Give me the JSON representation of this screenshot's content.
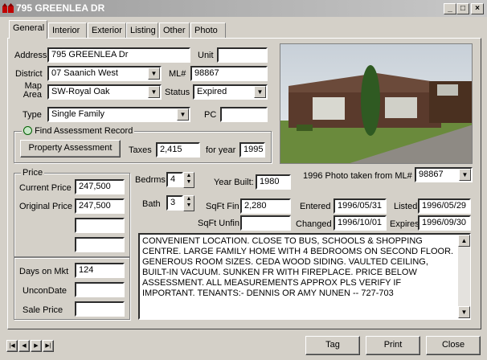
{
  "window": {
    "title": "795 GREENLEA DR",
    "min": "_",
    "max": "□",
    "close": "×"
  },
  "tabs": [
    {
      "label": "General"
    },
    {
      "label": "Interior"
    },
    {
      "label": "Exterior"
    },
    {
      "label": "Listing"
    },
    {
      "label": "Other"
    },
    {
      "label": "Photo"
    }
  ],
  "address": {
    "label": "Address",
    "value": "795 GREENLEA Dr",
    "unit_label": "Unit",
    "unit_value": ""
  },
  "district": {
    "label": "District",
    "value": "07 Saanich West",
    "ml_label": "ML#",
    "ml_value": "98867"
  },
  "map_area": {
    "label_line1": "Map",
    "label_line2": "Area",
    "value": "SW-Royal Oak",
    "status_label": "Status",
    "status_value": "Expired"
  },
  "type": {
    "label": "Type",
    "value": "Single Family",
    "pc_label": "PC",
    "pc_value": ""
  },
  "assessment": {
    "group_title": "Find Assessment Record",
    "button": "Property Assessment",
    "taxes_label": "Taxes",
    "taxes_value": "2,415",
    "year_label": "for year",
    "year_value": "1995"
  },
  "price": {
    "group_title": "Price",
    "current_label": "Current Price",
    "current_value": "247,500",
    "original_label": "Original Price",
    "original_value": "247,500",
    "extra1": "",
    "extra2": ""
  },
  "market": {
    "days_label": "Days on Mkt",
    "days_value": "124",
    "uncon_label": "UnconDate",
    "uncon_value": "",
    "sale_label": "Sale Price",
    "sale_value": ""
  },
  "rooms": {
    "bedrms_label": "Bedrms",
    "bedrms_value": "4",
    "bath_label": "Bath",
    "bath_value": "3"
  },
  "building": {
    "year_label": "Year Built:",
    "year_value": "1980",
    "sqft_fin_label": "SqFt Fin",
    "sqft_fin_value": "2,280",
    "sqft_unfin_label": "SqFt Unfin",
    "sqft_unfin_value": ""
  },
  "dates": {
    "entered_label": "Entered",
    "entered_value": "1996/05/31",
    "listed_label": "Listed",
    "listed_value": "1996/05/29",
    "changed_label": "Changed",
    "changed_value": "1996/10/01",
    "expires_label": "Expires",
    "expires_value": "1996/09/30"
  },
  "photo": {
    "caption": "1996 Photo taken from ML#",
    "ml_value": "98867"
  },
  "remarks": "CONVENIENT LOCATION. CLOSE TO BUS, SCHOOLS & SHOPPING CENTRE. LARGE FAMILY HOME WITH 4 BEDROOMS ON SECOND FLOOR. GENEROUS ROOM SIZES. CEDA WOOD SIDING. VAULTED CEILING, BUILT-IN VACUUM. SUNKEN FR WITH FIREPLACE. PRICE BELOW ASSESSMENT. ALL MEASUREMENTS APPROX PLS VERIFY IF IMPORTANT. TENANTS:- DENNIS OR AMY NUNEN -- 727-703",
  "nav": {
    "first": "|◀",
    "prev": "◀",
    "next": "▶",
    "last": "▶|"
  },
  "footer": {
    "tag": "Tag",
    "print": "Print",
    "close": "Close"
  }
}
